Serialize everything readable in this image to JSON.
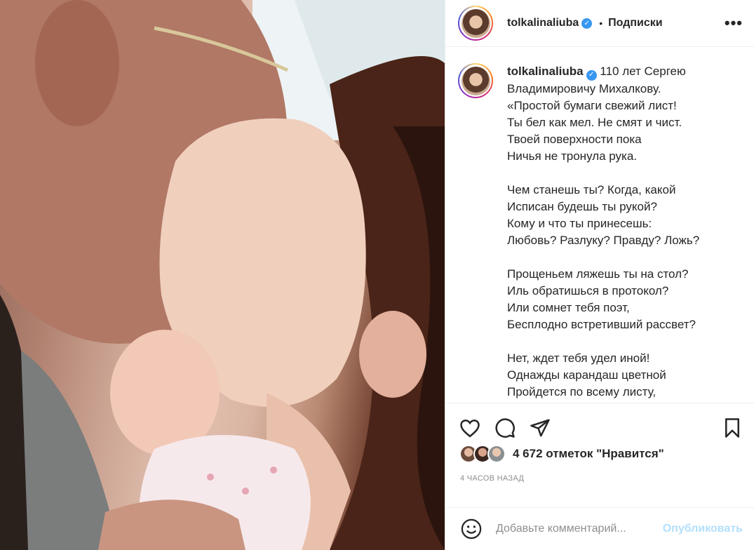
{
  "post": {
    "username": "tolkalinaliuba",
    "verified": true,
    "follow_separator": "•",
    "follow_label": "Подписки",
    "more_label": "•••"
  },
  "caption": {
    "username": "tolkalinaliuba",
    "stanzas": [
      "110 лет Сергею Владимировичу Михалкову.\n«Простой бумаги свежий лист!\nТы бел как мел. Не смят и чист.\nТвоей поверхности пока\nНичья не тронула рука.",
      "Чем станешь ты? Когда, какой\nИсписан будешь ты рукой?\nКому и что ты принесешь:\nЛюбовь? Разлуку? Правду? Ложь?",
      "Прощеньем ляжешь ты на стол?\nИль обратишься в протокол?\nИли сомнет тебя поэт,\nБесплодно встретивший рассвет?",
      "Нет, ждет тебя удел иной!\nОднажды карандаш цветной\nПройдется по всему листу,"
    ]
  },
  "actions": {
    "icons": [
      "heart-icon",
      "comment-icon",
      "share-icon",
      "bookmark-icon"
    ]
  },
  "likes": {
    "text": "4 672 отметок \"Нравится\""
  },
  "timestamp": "4 часов назад",
  "comment": {
    "placeholder": "Добавьте комментарий...",
    "publish_label": "Опубликовать"
  },
  "colors": {
    "accent": "#3897f0",
    "publish_disabled": "#b2dffc",
    "secondary_text": "#8e8e8e",
    "border": "#efefef"
  }
}
